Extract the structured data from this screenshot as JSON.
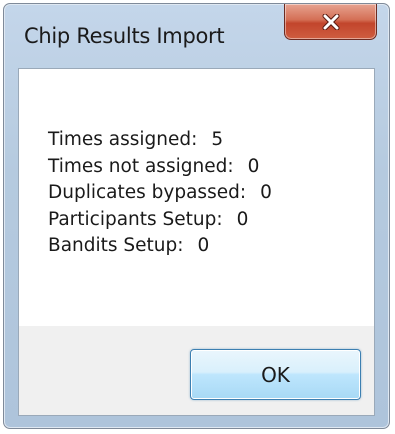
{
  "window": {
    "title": "Chip Results Import",
    "close_icon": "close-icon"
  },
  "results": [
    {
      "label": "Times assigned:",
      "value": "5"
    },
    {
      "label": "Times not assigned:",
      "value": "0"
    },
    {
      "label": "Duplicates bypassed:",
      "value": "0"
    },
    {
      "label": "Participants Setup:",
      "value": "0"
    },
    {
      "label": "Bandits Setup:",
      "value": "0"
    }
  ],
  "buttons": {
    "ok_label": "OK"
  },
  "colors": {
    "title_bar": "#b5cadf",
    "close_button": "#c2452c",
    "ok_button_border": "#3c7fb1",
    "footer": "#f0f0f0"
  }
}
